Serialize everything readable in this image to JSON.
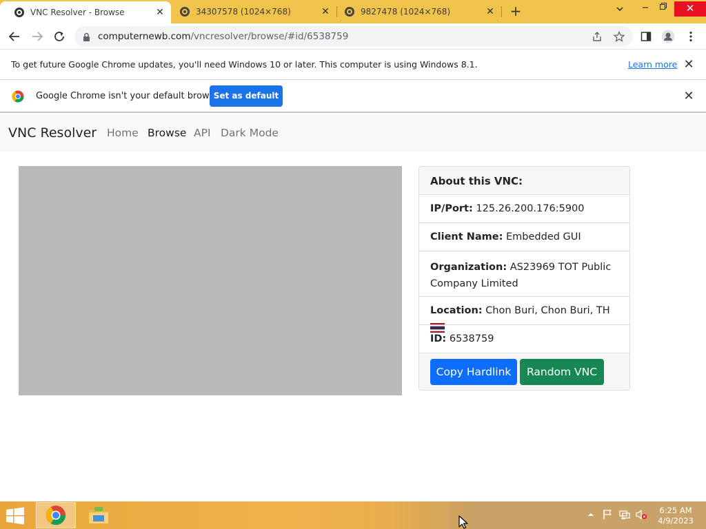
{
  "browser": {
    "tabs": [
      {
        "label": "VNC Resolver - Browse",
        "active": true
      },
      {
        "label": "34307578 (1024×768)",
        "active": false
      },
      {
        "label": "9827478 (1024×768)",
        "active": false
      }
    ],
    "url_host": "computernewb.com",
    "url_path": "/vncresolver/browse/#id/6538759"
  },
  "infobar_update": {
    "message": "To get future Google Chrome updates, you'll need Windows 10 or later. This computer is using Windows 8.1.",
    "link": "Learn more"
  },
  "infobar_default": {
    "message": "Google Chrome isn't your default browser",
    "button": "Set as default"
  },
  "site": {
    "brand": "VNC Resolver",
    "nav": [
      "Home",
      "Browse",
      "API",
      "Dark Mode"
    ]
  },
  "vnc_info": {
    "header": "About this VNC:",
    "ip_label": "IP/Port:",
    "ip_value": "125.26.200.176:5900",
    "client_label": "Client Name:",
    "client_value": "Embedded GUI",
    "org_label": "Organization:",
    "org_value": "AS23969 TOT Public Company Limited",
    "location_label": "Location:",
    "location_value": "Chon Buri, Chon Buri, TH",
    "id_label": "ID:",
    "id_value": "6538759",
    "copy_button": "Copy Hardlink",
    "random_button": "Random VNC"
  },
  "taskbar": {
    "time": "6:25 AM",
    "date": "4/9/2023"
  },
  "colors": {
    "tabstrip": "#f0c34a",
    "primary": "#0d6efd",
    "success": "#198754",
    "chrome_blue": "#1a73e8"
  }
}
